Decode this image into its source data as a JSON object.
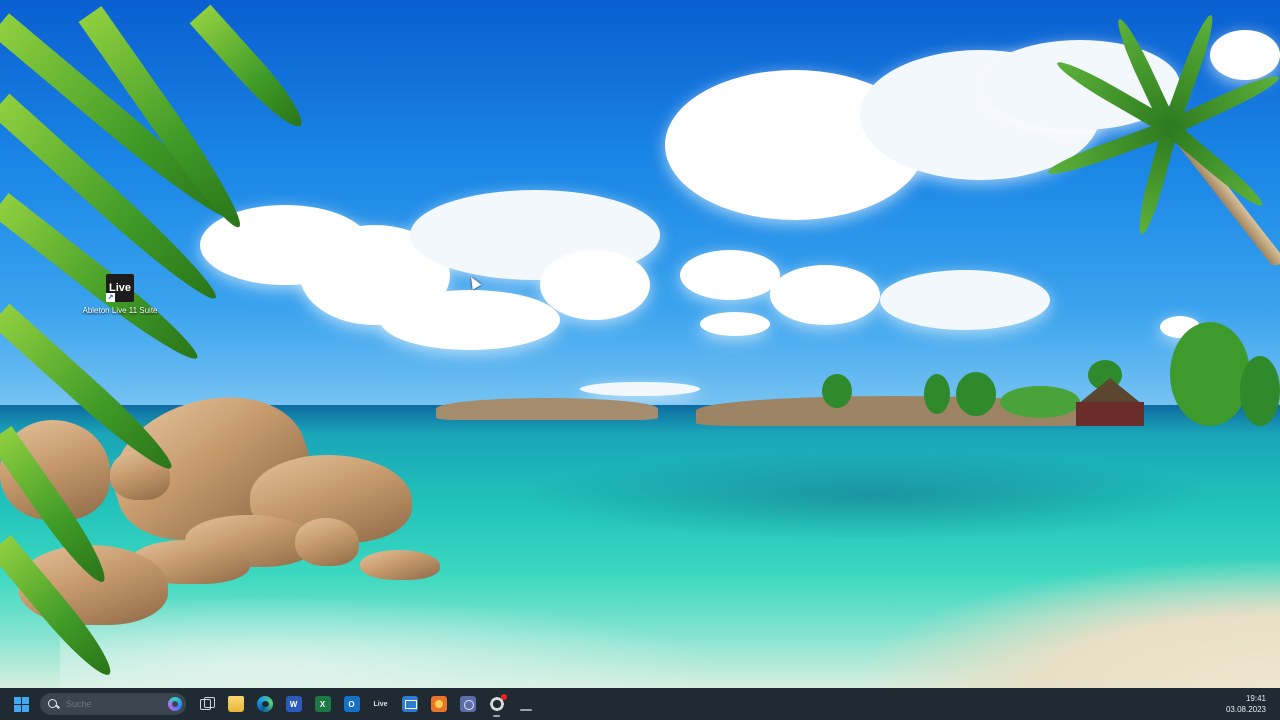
{
  "desktop": {
    "icons": [
      {
        "tile_text": "Live",
        "label": "Ableton Live 11 Suite"
      }
    ]
  },
  "taskbar": {
    "search": {
      "placeholder": "Suche"
    },
    "apps": [
      {
        "name": "task-view-icon",
        "text": ""
      },
      {
        "name": "file-explorer-icon",
        "text": ""
      },
      {
        "name": "edge-icon",
        "text": ""
      },
      {
        "name": "word-icon",
        "text": "W"
      },
      {
        "name": "excel-icon",
        "text": "X"
      },
      {
        "name": "outlook-icon",
        "text": "O"
      },
      {
        "name": "ableton-live-icon",
        "text": "Live"
      },
      {
        "name": "mail-icon",
        "text": ""
      },
      {
        "name": "paint-icon",
        "text": ""
      },
      {
        "name": "control-panel-icon",
        "text": ""
      },
      {
        "name": "browser-icon",
        "text": ""
      },
      {
        "name": "blank-app-icon",
        "text": ""
      }
    ],
    "clock": {
      "time": "19:41",
      "date": "03.08.2023"
    }
  },
  "colors": {
    "taskbar_bg": "#1f2a33",
    "windows_accent": "#3fa9f5",
    "sky": "#1a86e6",
    "sea": "#21c2bb"
  }
}
